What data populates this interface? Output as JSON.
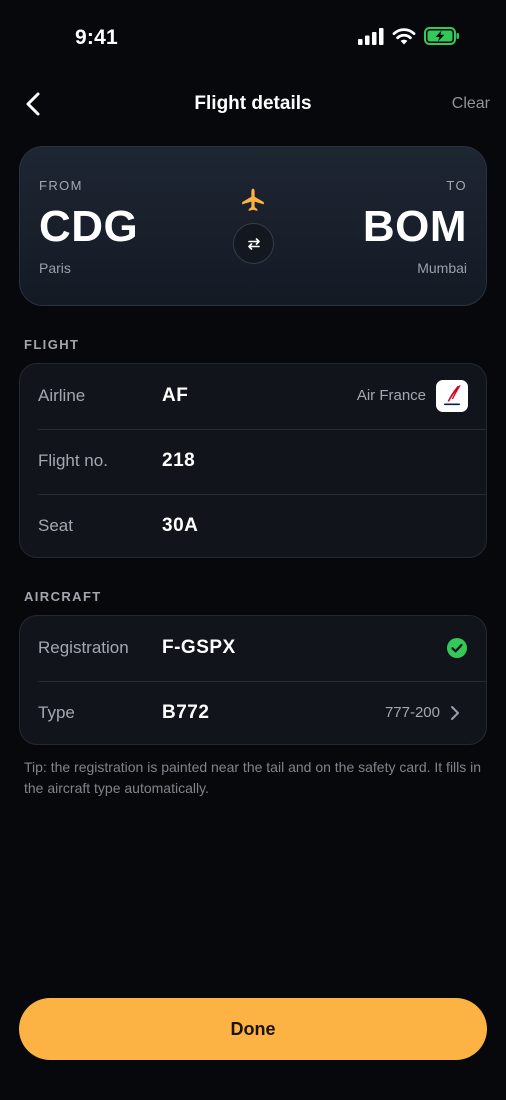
{
  "status_bar": {
    "time": "9:41"
  },
  "nav": {
    "title": "Flight details",
    "clear_label": "Clear"
  },
  "route": {
    "from_label": "FROM",
    "from_code": "CDG",
    "from_city": "Paris",
    "to_label": "TO",
    "to_code": "BOM",
    "to_city": "Mumbai"
  },
  "flight_section": {
    "header": "FLIGHT",
    "rows": [
      {
        "label": "Airline",
        "value": "AF",
        "detail": "Air France"
      },
      {
        "label": "Flight no.",
        "value": "218"
      },
      {
        "label": "Seat",
        "value": "30A"
      }
    ]
  },
  "aircraft_section": {
    "header": "AIRCRAFT",
    "rows": [
      {
        "label": "Registration",
        "value": "F-GSPX"
      },
      {
        "label": "Type",
        "value": "B772",
        "detail": "777-200"
      }
    ]
  },
  "tip": "Tip: the registration is painted near the tail and on the safety card. It fills in the aircraft type automatically.",
  "done_label": "Done",
  "colors": {
    "accent": "#fdb343",
    "success": "#34c759",
    "battery": "#34c759",
    "airline_brand": "#d6001c"
  },
  "icons": {
    "back": "chevron-left-icon",
    "plane": "airplane-icon",
    "swap": "swap-arrows-icon",
    "verified": "check-circle-icon",
    "disclosure": "chevron-right-icon"
  }
}
